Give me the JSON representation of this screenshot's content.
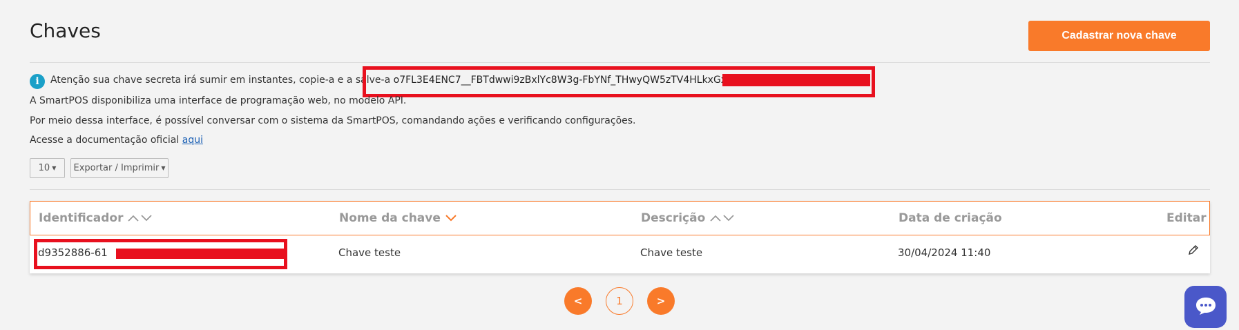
{
  "header": {
    "title": "Chaves",
    "new_key_button": "Cadastrar nova chave"
  },
  "alert": {
    "icon": "info-icon",
    "message": "Atenção sua chave secreta irá sumir em instantes, copie-a e a salve-a",
    "secret_key_visible": "o7FL3E4ENC7__FBTdwwi9zBxlYc8W3g-FbYNf_THwyQW5zTV4HLkxGxjbveq"
  },
  "description": {
    "line1": "A SmartPOS disponibiliza uma interface de programação web, no modelo API.",
    "line2": "Por meio dessa interface, é possível conversar com o sistema da SmartPOS, comandando ações e verificando configurações.",
    "line3_prefix": "Acesse a documentação oficial",
    "line3_link": "aqui"
  },
  "controls": {
    "page_size": "10",
    "export_label": "Exportar / Imprimir"
  },
  "table": {
    "columns": [
      "Identificador",
      "Nome da chave",
      "Descrição",
      "Data de criação",
      "Editar"
    ],
    "rows": [
      {
        "identificador": "d9352886-61",
        "nome": "Chave teste",
        "descricao": "Chave teste",
        "data": "30/04/2024 11:40",
        "edit_icon": "pencil-icon"
      }
    ]
  },
  "pagination": {
    "prev": "<",
    "current": "1",
    "next": ">"
  },
  "colors": {
    "accent": "#f97a2a",
    "redaction": "#e8101e",
    "info": "#1aa0c8",
    "chat": "#4a58c9"
  },
  "chat": {
    "icon": "chat-bubble-icon"
  }
}
